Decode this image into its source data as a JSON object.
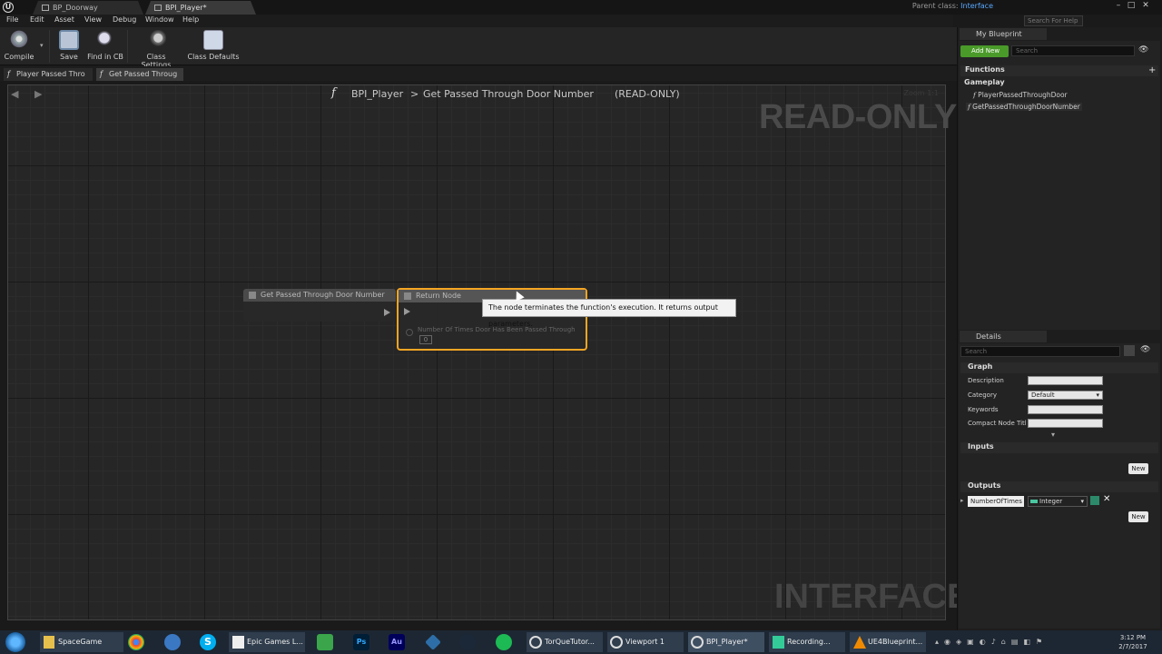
{
  "window": {
    "tabs": [
      {
        "label": "BP_Doorway",
        "active": false
      },
      {
        "label": "BPI_Player*",
        "active": true
      }
    ],
    "parent_class_label": "Parent class:",
    "parent_class_value": "Interface",
    "help_search_placeholder": "Search For Help"
  },
  "menu": [
    "File",
    "Edit",
    "Asset",
    "View",
    "Debug",
    "Window",
    "Help"
  ],
  "toolbar": {
    "compile": "Compile",
    "save": "Save",
    "find": "Find in CB",
    "class_settings": "Class Settings",
    "class_defaults": "Class Defaults"
  },
  "function_tabs": [
    {
      "label": "Player Passed Thro",
      "active": false
    },
    {
      "label": "Get Passed Throug",
      "active": true
    }
  ],
  "graph": {
    "breadcrumb_root": "BPI_Player",
    "breadcrumb_sep": ">",
    "breadcrumb_func": "Get Passed Through Door Number",
    "breadcrumb_mode": "(READ-ONLY)",
    "zoom": "Zoom 1:1",
    "watermark_top": "READ-ONLY",
    "watermark_bottom": "INTERFACE",
    "entry_node_title": "Get Passed Through Door Number",
    "return_node_title": "Return Node",
    "return_pin_label": "Number Of Times Door Has Been Passed Through",
    "return_pin_value": "0",
    "tooltip": "The node terminates the function's execution. It returns output parameters."
  },
  "my_blueprint": {
    "tab": "My Blueprint",
    "add_new": "Add New",
    "search_placeholder": "Search",
    "functions_header": "Functions",
    "category": "Gameplay",
    "functions": [
      "PlayerPassedThroughDoor",
      "GetPassedThroughDoorNumber"
    ]
  },
  "details": {
    "tab": "Details",
    "search_placeholder": "Search",
    "graph_header": "Graph",
    "props": [
      {
        "label": "Description",
        "value": ""
      },
      {
        "label": "Category",
        "value": "Default"
      },
      {
        "label": "Keywords",
        "value": ""
      },
      {
        "label": "Compact Node Titl",
        "value": ""
      }
    ],
    "inputs_header": "Inputs",
    "outputs_header": "Outputs",
    "new_label": "New",
    "output_name": "NumberOfTimes",
    "output_type": "Integer"
  },
  "taskbar": {
    "items": [
      "SpaceGame",
      "Epic Games L...",
      "TorQueTutor...",
      "Viewport 1",
      "BPI_Player*",
      "Recording...",
      "UE4Blueprint..."
    ],
    "time": "3:12 PM",
    "date": "2/7/2017"
  },
  "colors": {
    "accent_orange": "#f5a623",
    "add_new_green": "#4a9a2a",
    "parent_class_blue": "#5aa8ff"
  }
}
